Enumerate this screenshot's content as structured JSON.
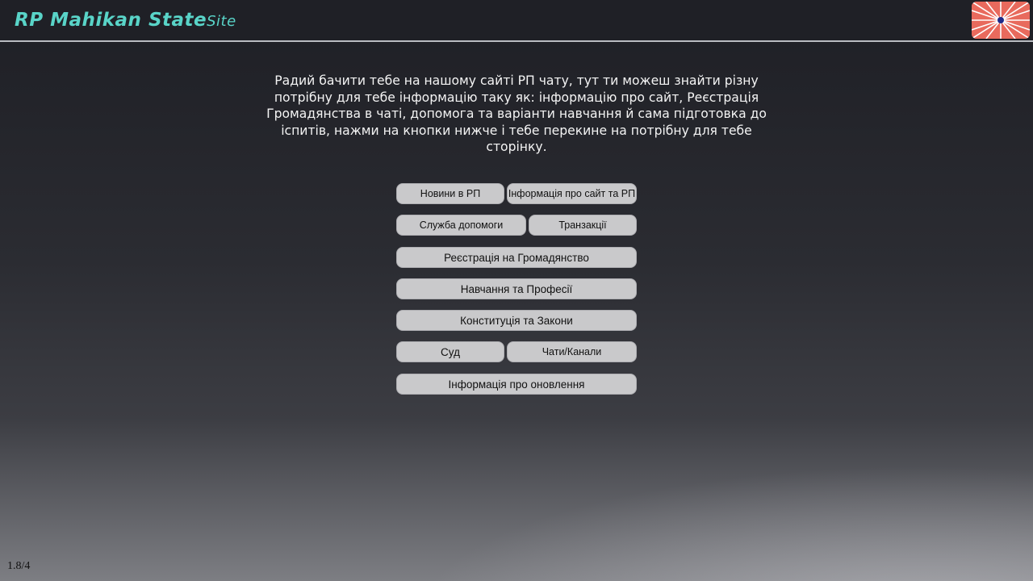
{
  "header": {
    "brand_main": "RP Mahikan State",
    "brand_suffix": "Site",
    "flag_icon": "flag-icon"
  },
  "intro": {
    "text": "Радий бачити тебе на нашому сайті РП чату, тут ти можеш знайти різну потрібну для тебе інформацію таку як: інформацію про сайт, Реєстрація Громадянства в чаті, допомога та варіанти навчання й сама підготовка до іспитів, нажми на кнопки нижче і тебе перекине на потрібну для тебе сторінку."
  },
  "buttons": {
    "news": "Новини в РП",
    "about": "Інформація про сайт та РП",
    "support": "Служба допомоги",
    "transactions": "Транзакції",
    "registration": "Реєстрація на Громадянство",
    "education": "Навчання та Професії",
    "constitution": "Конституція та Закони",
    "court": "Суд",
    "chats": "Чати/Канали",
    "updates": "Інформація про оновлення"
  },
  "footer": {
    "version": "1.8/4"
  },
  "colors": {
    "brand": "#59d4c8",
    "button_bg": "#c9c9cb",
    "flag_bg": "#e86a5d",
    "flag_cross": "#ffffff",
    "flag_center": "#1e2a8a"
  }
}
